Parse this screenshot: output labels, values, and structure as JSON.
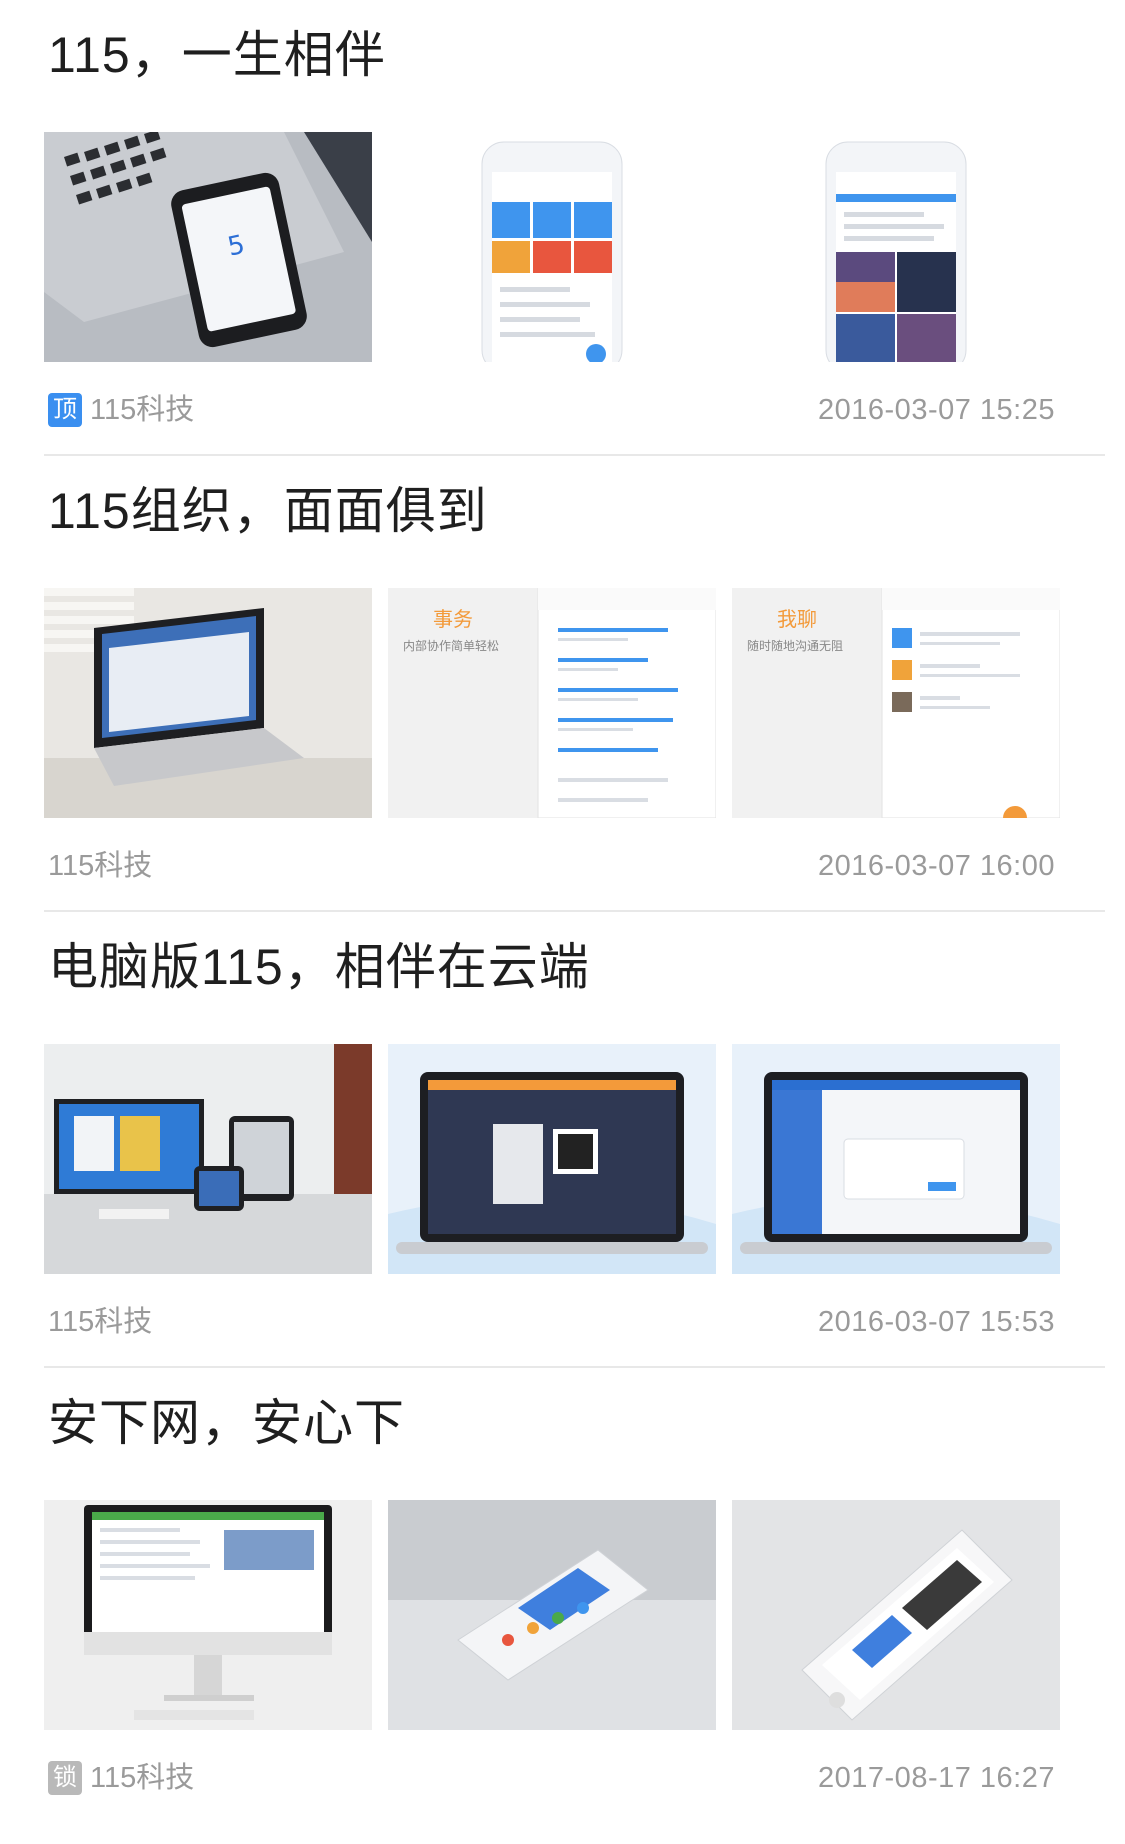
{
  "articles": [
    {
      "title": "115，一生相伴",
      "badge": {
        "label": "顶",
        "color": "#3a8ff0"
      },
      "source": "115科技",
      "time": "2016-03-07 15:25",
      "thumbs": [
        {
          "icon": "laptop-phone-photo"
        },
        {
          "icon": "phone-app-grid-screenshot"
        },
        {
          "icon": "phone-app-photos-screenshot"
        }
      ]
    },
    {
      "title": "115组织，面面俱到",
      "badge": null,
      "source": "115科技",
      "time": "2016-03-07 16:00",
      "thumbs": [
        {
          "icon": "laptop-desk-photo"
        },
        {
          "icon": "app-tasks-promo",
          "headline": "事务",
          "sub": "内部协作简单轻松"
        },
        {
          "icon": "app-chat-promo",
          "headline": "我聊",
          "sub": "随时随地沟通无阻"
        }
      ]
    },
    {
      "title": "电脑版115，相伴在云端",
      "badge": null,
      "source": "115科技",
      "time": "2016-03-07 15:53",
      "thumbs": [
        {
          "icon": "desktop-devices-photo"
        },
        {
          "icon": "macbook-qr-login-screenshot"
        },
        {
          "icon": "macbook-dialog-screenshot"
        }
      ]
    },
    {
      "title": "安下网，安心下",
      "badge": {
        "label": "锁",
        "color": "#b9b9b9"
      },
      "source": "115科技",
      "time": "2017-08-17 16:27",
      "thumbs": [
        {
          "icon": "imac-website-photo"
        },
        {
          "icon": "phone-angled-app-photo"
        },
        {
          "icon": "iphone-angled-app-photo"
        }
      ]
    }
  ],
  "colors": {
    "accent_orange": "#f39a3a",
    "accent_blue": "#3a8ff0"
  }
}
